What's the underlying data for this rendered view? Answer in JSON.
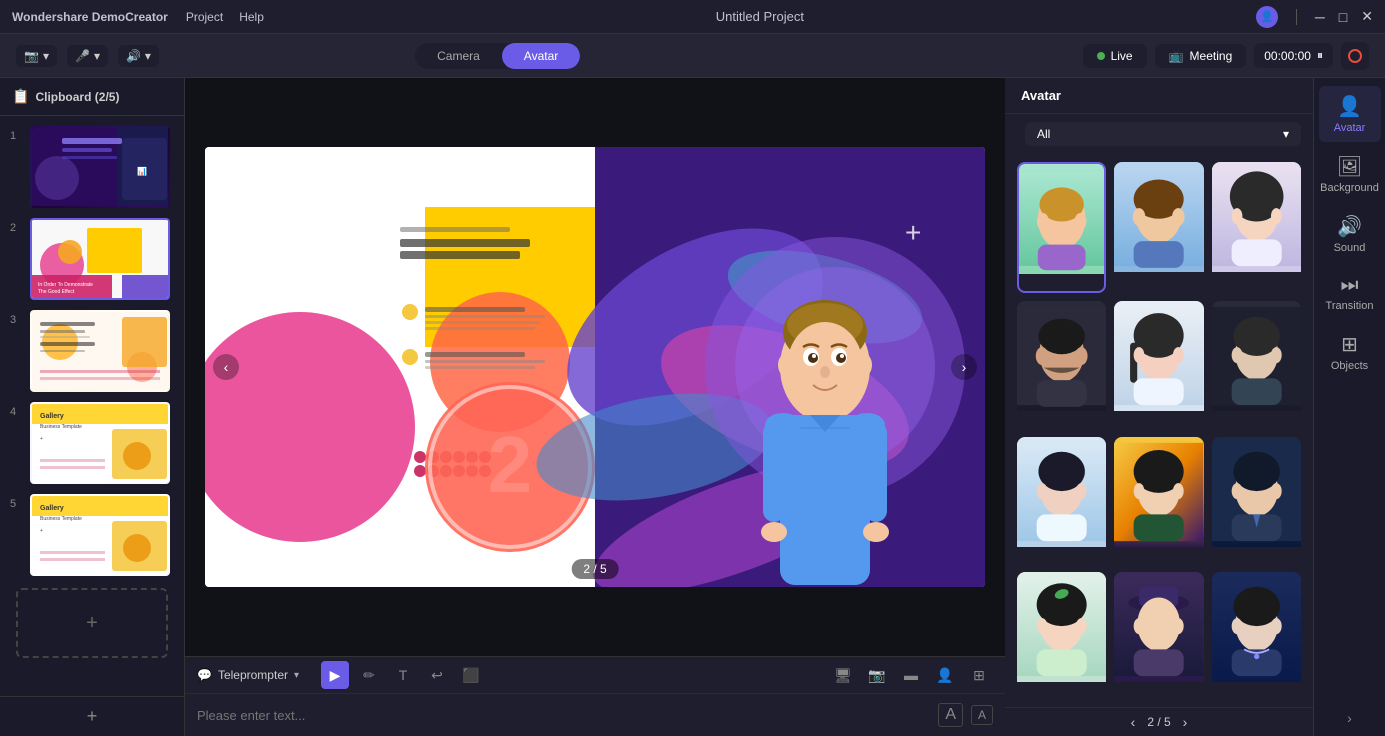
{
  "app": {
    "brand": "Wondershare DemoCreator",
    "project_title": "Untitled Project",
    "menu": [
      "Project",
      "Help"
    ]
  },
  "toolbar": {
    "camera_label": "Camera",
    "avatar_label": "Avatar",
    "live_label": "Live",
    "meeting_label": "Meeting",
    "timer": "00:00:00",
    "clipboard_label": "Clipboard (2/5)"
  },
  "slides": [
    {
      "num": "1",
      "active": false,
      "label": "slide1"
    },
    {
      "num": "2",
      "active": true,
      "label": "slide2"
    },
    {
      "num": "3",
      "active": false,
      "label": "slide3"
    },
    {
      "num": "4",
      "active": false,
      "label": "slide4"
    },
    {
      "num": "5",
      "active": false,
      "label": "slide5"
    }
  ],
  "preview": {
    "page_current": "2",
    "page_total": "5",
    "page_display": "2 / 5"
  },
  "teleprompter": {
    "label": "Teleprompter",
    "placeholder": "Please enter text...",
    "font_increase": "A",
    "font_decrease": "A"
  },
  "avatar_panel": {
    "tab_label": "Avatar",
    "filter_label": "All",
    "page_display": "2 / 5",
    "avatars": [
      {
        "id": "av1",
        "color_class": "av1"
      },
      {
        "id": "av2",
        "color_class": "av2"
      },
      {
        "id": "av3",
        "color_class": "av3"
      },
      {
        "id": "av4",
        "color_class": "av4"
      },
      {
        "id": "av5",
        "color_class": "av5"
      },
      {
        "id": "av6",
        "color_class": "av6"
      },
      {
        "id": "av7",
        "color_class": "av7"
      },
      {
        "id": "av8",
        "color_class": "av8"
      },
      {
        "id": "av9",
        "color_class": "av9"
      },
      {
        "id": "av10",
        "color_class": "av10"
      },
      {
        "id": "av11",
        "color_class": "av11"
      },
      {
        "id": "av12",
        "color_class": "av12"
      }
    ]
  },
  "right_sidebar": {
    "items": [
      {
        "id": "avatar",
        "label": "Avatar",
        "active": true,
        "icon": "👤"
      },
      {
        "id": "background",
        "label": "Background",
        "active": false,
        "icon": "🖼"
      },
      {
        "id": "sound",
        "label": "Sound",
        "active": false,
        "icon": "🔊"
      },
      {
        "id": "transition",
        "label": "Transition",
        "active": false,
        "icon": "⏭"
      },
      {
        "id": "objects",
        "label": "Objects",
        "active": false,
        "icon": "⊞"
      }
    ]
  },
  "window_controls": {
    "minimize": "─",
    "maximize": "□",
    "close": "✕"
  }
}
